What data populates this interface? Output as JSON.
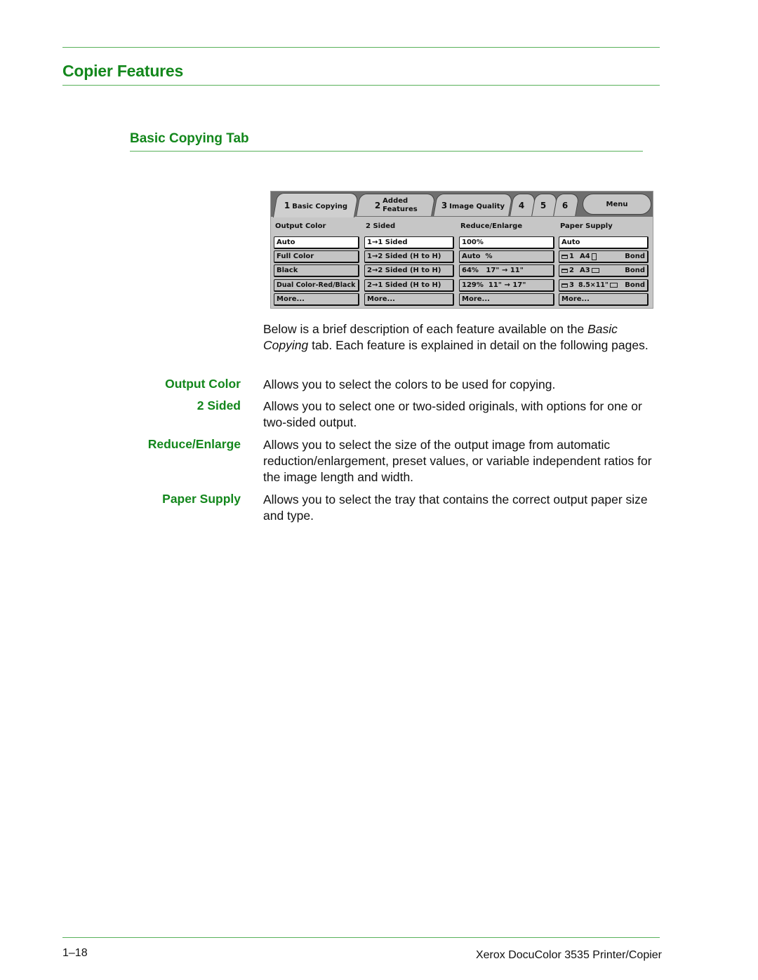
{
  "page": {
    "section_title": "Copier Features",
    "subsection_title": "Basic Copying Tab",
    "intro_before_italic": "Below is a brief description of each feature available on the ",
    "intro_italic": "Basic Copying",
    "intro_after_italic": " tab.  Each feature is explained in detail on the following pages.",
    "accent_color": "#13871c"
  },
  "copier_ui": {
    "tabs": [
      {
        "number": "1",
        "label": "Basic Copying",
        "active": true
      },
      {
        "number": "2",
        "label_line1": "Added",
        "label_line2": "Features",
        "active": false
      },
      {
        "number": "3",
        "label": "Image Quality",
        "active": false
      },
      {
        "number": "4",
        "label": "",
        "active": false
      },
      {
        "number": "5",
        "label": "",
        "active": false
      },
      {
        "number": "6",
        "label": "",
        "active": false
      }
    ],
    "menu_label": "Menu",
    "columns": [
      {
        "label": "Output Color",
        "options": [
          {
            "text": "Auto",
            "selected": true
          },
          {
            "text": "Full Color",
            "selected": false
          },
          {
            "text": "Black",
            "selected": false
          },
          {
            "text": "Dual Color-Red/Black",
            "selected": false
          },
          {
            "text": "More...",
            "selected": false
          }
        ]
      },
      {
        "label": "2 Sided",
        "options": [
          {
            "text": "1→1 Sided",
            "selected": true
          },
          {
            "text": "1→2 Sided (H to H)",
            "selected": false
          },
          {
            "text": "2→2 Sided (H to H)",
            "selected": false
          },
          {
            "text": "2→1 Sided (H to H)",
            "selected": false
          },
          {
            "text": "More...",
            "selected": false
          }
        ]
      },
      {
        "label": "Reduce/Enlarge",
        "options": [
          {
            "text": "100%",
            "selected": true
          },
          {
            "text": "Auto  %",
            "selected": false
          },
          {
            "text": "64%   17\" → 11\"",
            "selected": false
          },
          {
            "text": "129%  11\" → 17\"",
            "selected": false
          },
          {
            "text": "More...",
            "selected": false
          }
        ]
      },
      {
        "label": "Paper Supply",
        "options": [
          {
            "text": "Auto",
            "selected": true
          },
          {
            "tray": "1",
            "size": "A4",
            "orientation": "portrait",
            "type": "Bond",
            "selected": false
          },
          {
            "tray": "2",
            "size": "A3",
            "orientation": "landscape",
            "type": "Bond",
            "selected": false
          },
          {
            "tray": "3",
            "size": "8.5×11\"",
            "orientation": "landscape",
            "type": "Bond",
            "selected": false
          },
          {
            "text": "More...",
            "selected": false
          }
        ]
      }
    ]
  },
  "features": [
    {
      "term": "Output Color",
      "description": "Allows you to select the colors to be used for copying."
    },
    {
      "term": "2 Sided",
      "description": "Allows you to select one or two-sided originals, with options for one or two-sided output."
    },
    {
      "term": "Reduce/Enlarge",
      "description": "Allows you to select the size of the output image from automatic reduction/enlargement, preset values, or variable independent ratios for the image length and width."
    },
    {
      "term": "Paper Supply",
      "description": "Allows you to select the tray that contains the correct output paper size and type."
    }
  ],
  "footer": {
    "page_number": "1–18",
    "product": "Xerox DocuColor 3535 Printer/Copier"
  }
}
